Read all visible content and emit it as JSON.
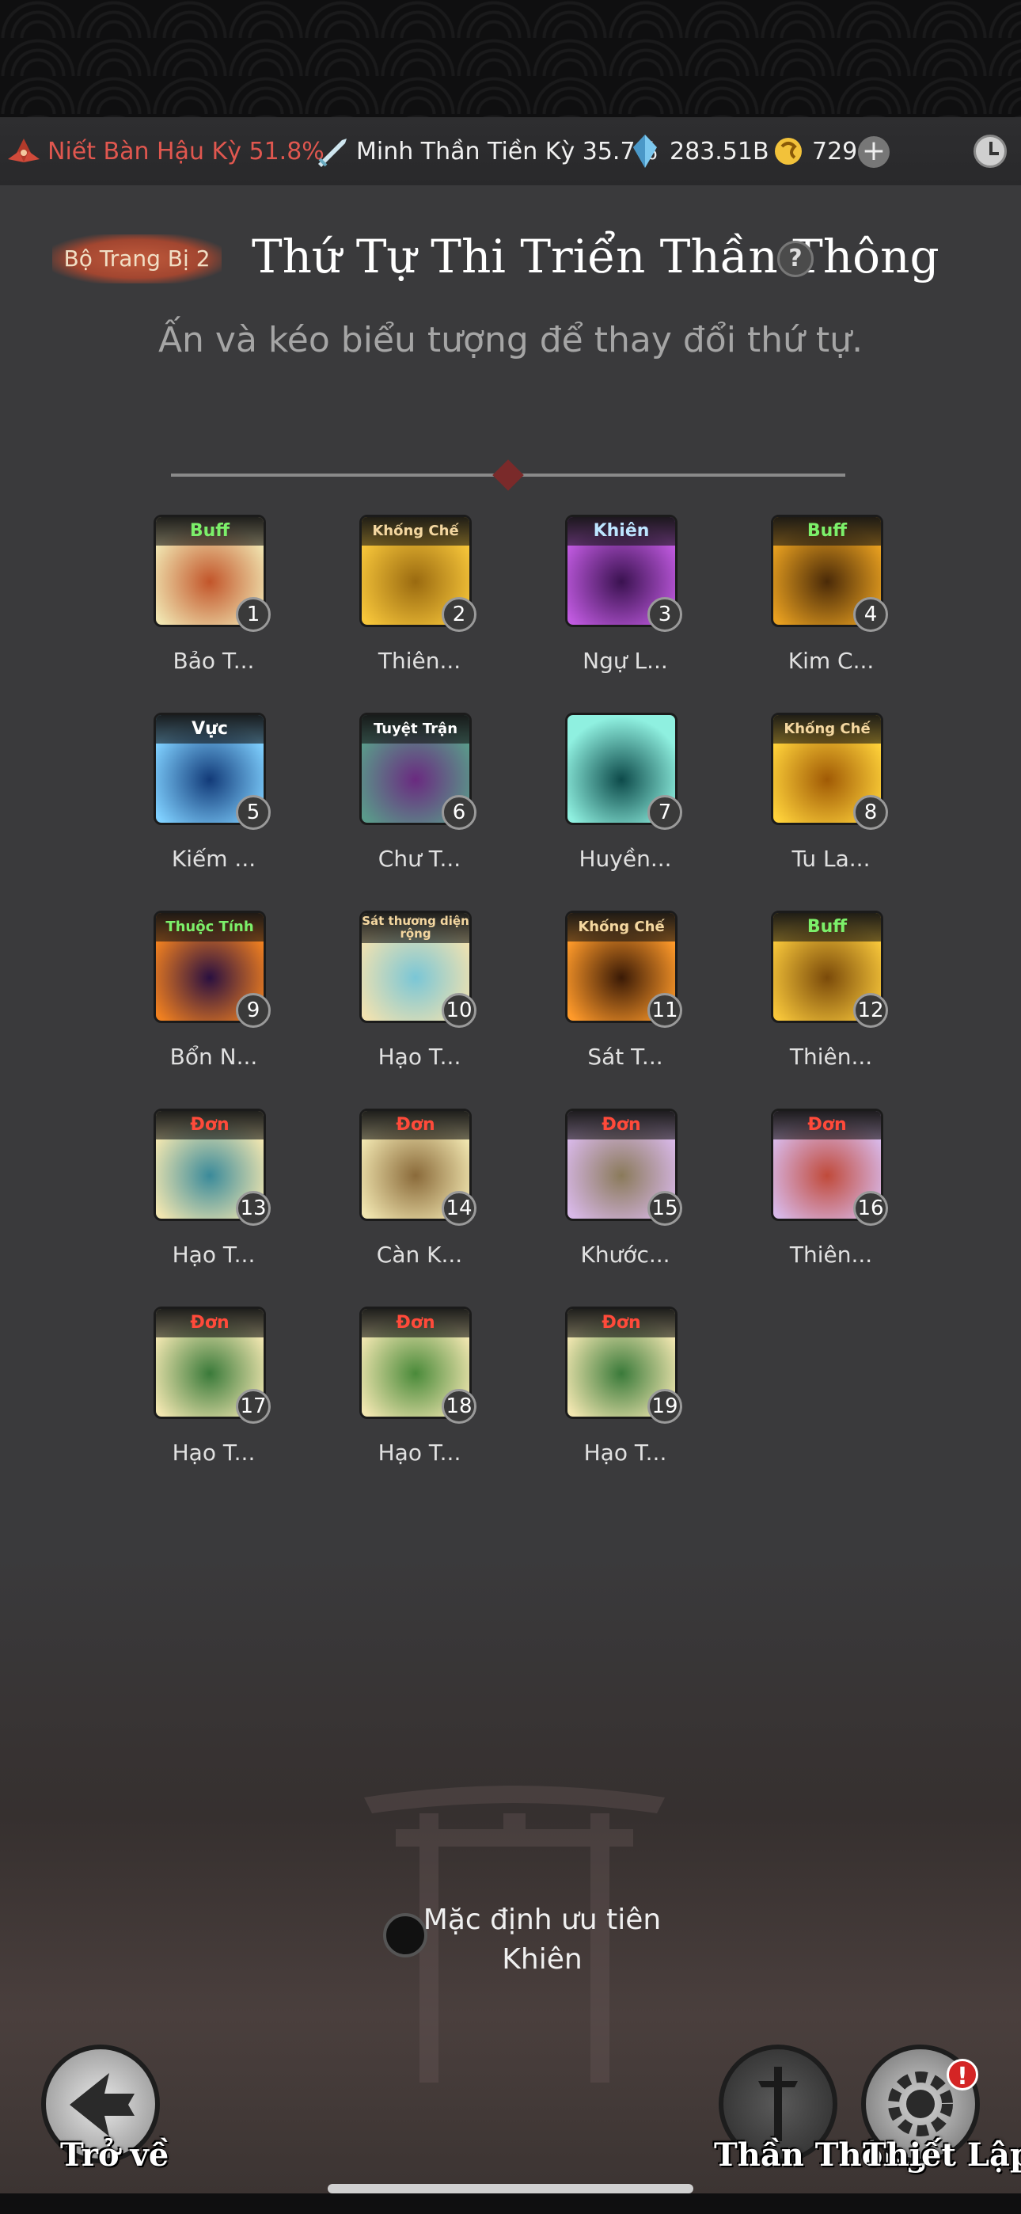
{
  "resources": {
    "realm_primary": "Niết Bàn Hậu Kỳ 51.8%",
    "realm_secondary": "Minh Thần Tiền Kỳ 35.7%",
    "gems": "283.51B",
    "coins": "729",
    "plus_symbol": "+"
  },
  "header": {
    "equip_set": "Bộ Trang Bị 2",
    "title": "Thứ Tự Thi Triển Thần Thông",
    "help_symbol": "?",
    "subtitle": "Ấn và kéo biểu tượng để thay đổi thứ tự."
  },
  "skills": [
    {
      "num": "1",
      "tag": "Buff",
      "tag_color": "#7cf06a",
      "label": "Bảo T...",
      "color1": "#f0e4b0",
      "color2": "#c2552a"
    },
    {
      "num": "2",
      "tag": "Khống Chế",
      "tag_color": "#f4d7a0",
      "label": "Thiên...",
      "color1": "#f7c63a",
      "color2": "#9a6a10"
    },
    {
      "num": "3",
      "tag": "Khiên",
      "tag_color": "#bde5ff",
      "label": "Ngự L...",
      "color1": "#c05ae0",
      "color2": "#3a1250"
    },
    {
      "num": "4",
      "tag": "Buff",
      "tag_color": "#7cf06a",
      "label": "Kim C...",
      "color1": "#e8a020",
      "color2": "#4a2a08"
    },
    {
      "num": "5",
      "tag": "Vực",
      "tag_color": "#ffffff",
      "label": "Kiếm ...",
      "color1": "#7fd0ff",
      "color2": "#123a78"
    },
    {
      "num": "6",
      "tag": "Tuyệt Trận",
      "tag_color": "#ffffff",
      "label": "Chư T...",
      "color1": "#5a9a8a",
      "color2": "#6a2a80"
    },
    {
      "num": "7",
      "tag": "",
      "tag_color": "#ffffff",
      "label": "Huyền...",
      "color1": "#8ff0e0",
      "color2": "#0d4a4a"
    },
    {
      "num": "8",
      "tag": "Khống Chế",
      "tag_color": "#f4d7a0",
      "label": "Tu La...",
      "color1": "#ffd23a",
      "color2": "#a05a05"
    },
    {
      "num": "9",
      "tag": "Thuộc Tính",
      "tag_color": "#7cf06a",
      "label": "Bổn N...",
      "color1": "#f08020",
      "color2": "#2a1040"
    },
    {
      "num": "10",
      "tag": "Sát thương diện rộng",
      "tag_color": "#f4d7a0",
      "label": "Hạo T...",
      "color1": "#f1e2b0",
      "color2": "#7ac6d6"
    },
    {
      "num": "11",
      "tag": "Khống Chế",
      "tag_color": "#f4d7a0",
      "label": "Sát T...",
      "color1": "#ff9a2a",
      "color2": "#3a1a06"
    },
    {
      "num": "12",
      "tag": "Buff",
      "tag_color": "#7cf06a",
      "label": "Thiên...",
      "color1": "#f7c63a",
      "color2": "#7a4a0a"
    },
    {
      "num": "13",
      "tag": "Đơn",
      "tag_color": "#ff4a3a",
      "label": "Hạo T...",
      "color1": "#f1e6b0",
      "color2": "#3a8a9a"
    },
    {
      "num": "14",
      "tag": "Đơn",
      "tag_color": "#ff4a3a",
      "label": "Càn K...",
      "color1": "#f1e6b0",
      "color2": "#8a6a3a"
    },
    {
      "num": "15",
      "tag": "Đơn",
      "tag_color": "#ff4a3a",
      "label": "Khước...",
      "color1": "#d8b8e8",
      "color2": "#8a7a5a"
    },
    {
      "num": "16",
      "tag": "Đơn",
      "tag_color": "#ff4a3a",
      "label": "Thiên...",
      "color1": "#d8b8e8",
      "color2": "#c04a3a"
    },
    {
      "num": "17",
      "tag": "Đơn",
      "tag_color": "#ff4a3a",
      "label": "Hạo T...",
      "color1": "#f1e6b0",
      "color2": "#3a7a3a"
    },
    {
      "num": "18",
      "tag": "Đơn",
      "tag_color": "#ff4a3a",
      "label": "Hạo T...",
      "color1": "#f1e6b0",
      "color2": "#4a8a3a"
    },
    {
      "num": "19",
      "tag": "Đơn",
      "tag_color": "#ff4a3a",
      "label": "Hạo T...",
      "color1": "#f1e6b0",
      "color2": "#3a7a3a"
    }
  ],
  "priority": {
    "line1": "Mặc định ưu tiên",
    "line2": "Khiên"
  },
  "bottom_nav": {
    "back": "Trở về",
    "magic": "Thần Thông",
    "settings": "Thiết Lập",
    "alert": "!"
  }
}
